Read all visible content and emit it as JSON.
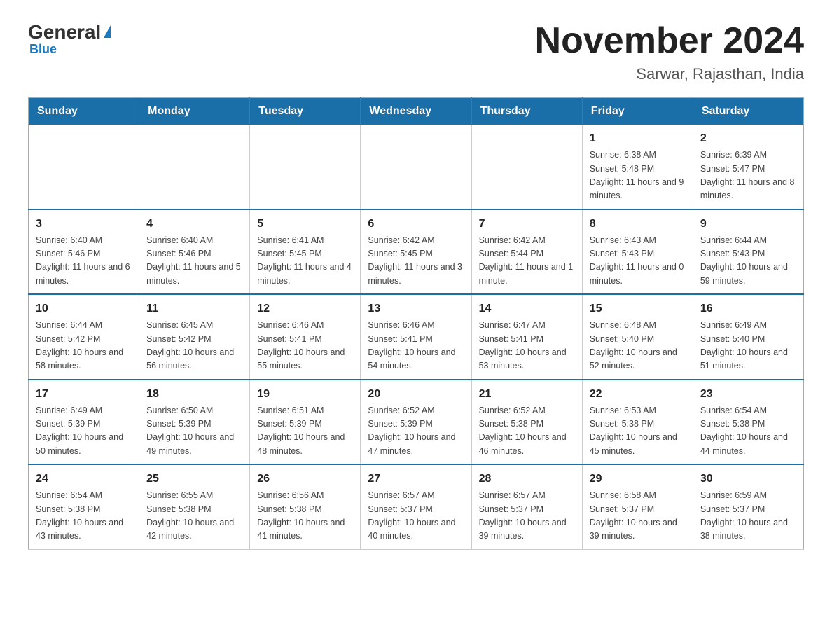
{
  "logo": {
    "general": "General",
    "blue": "Blue"
  },
  "header": {
    "title": "November 2024",
    "location": "Sarwar, Rajasthan, India"
  },
  "weekdays": [
    "Sunday",
    "Monday",
    "Tuesday",
    "Wednesday",
    "Thursday",
    "Friday",
    "Saturday"
  ],
  "weeks": [
    [
      {
        "day": "",
        "info": ""
      },
      {
        "day": "",
        "info": ""
      },
      {
        "day": "",
        "info": ""
      },
      {
        "day": "",
        "info": ""
      },
      {
        "day": "",
        "info": ""
      },
      {
        "day": "1",
        "info": "Sunrise: 6:38 AM\nSunset: 5:48 PM\nDaylight: 11 hours and 9 minutes."
      },
      {
        "day": "2",
        "info": "Sunrise: 6:39 AM\nSunset: 5:47 PM\nDaylight: 11 hours and 8 minutes."
      }
    ],
    [
      {
        "day": "3",
        "info": "Sunrise: 6:40 AM\nSunset: 5:46 PM\nDaylight: 11 hours and 6 minutes."
      },
      {
        "day": "4",
        "info": "Sunrise: 6:40 AM\nSunset: 5:46 PM\nDaylight: 11 hours and 5 minutes."
      },
      {
        "day": "5",
        "info": "Sunrise: 6:41 AM\nSunset: 5:45 PM\nDaylight: 11 hours and 4 minutes."
      },
      {
        "day": "6",
        "info": "Sunrise: 6:42 AM\nSunset: 5:45 PM\nDaylight: 11 hours and 3 minutes."
      },
      {
        "day": "7",
        "info": "Sunrise: 6:42 AM\nSunset: 5:44 PM\nDaylight: 11 hours and 1 minute."
      },
      {
        "day": "8",
        "info": "Sunrise: 6:43 AM\nSunset: 5:43 PM\nDaylight: 11 hours and 0 minutes."
      },
      {
        "day": "9",
        "info": "Sunrise: 6:44 AM\nSunset: 5:43 PM\nDaylight: 10 hours and 59 minutes."
      }
    ],
    [
      {
        "day": "10",
        "info": "Sunrise: 6:44 AM\nSunset: 5:42 PM\nDaylight: 10 hours and 58 minutes."
      },
      {
        "day": "11",
        "info": "Sunrise: 6:45 AM\nSunset: 5:42 PM\nDaylight: 10 hours and 56 minutes."
      },
      {
        "day": "12",
        "info": "Sunrise: 6:46 AM\nSunset: 5:41 PM\nDaylight: 10 hours and 55 minutes."
      },
      {
        "day": "13",
        "info": "Sunrise: 6:46 AM\nSunset: 5:41 PM\nDaylight: 10 hours and 54 minutes."
      },
      {
        "day": "14",
        "info": "Sunrise: 6:47 AM\nSunset: 5:41 PM\nDaylight: 10 hours and 53 minutes."
      },
      {
        "day": "15",
        "info": "Sunrise: 6:48 AM\nSunset: 5:40 PM\nDaylight: 10 hours and 52 minutes."
      },
      {
        "day": "16",
        "info": "Sunrise: 6:49 AM\nSunset: 5:40 PM\nDaylight: 10 hours and 51 minutes."
      }
    ],
    [
      {
        "day": "17",
        "info": "Sunrise: 6:49 AM\nSunset: 5:39 PM\nDaylight: 10 hours and 50 minutes."
      },
      {
        "day": "18",
        "info": "Sunrise: 6:50 AM\nSunset: 5:39 PM\nDaylight: 10 hours and 49 minutes."
      },
      {
        "day": "19",
        "info": "Sunrise: 6:51 AM\nSunset: 5:39 PM\nDaylight: 10 hours and 48 minutes."
      },
      {
        "day": "20",
        "info": "Sunrise: 6:52 AM\nSunset: 5:39 PM\nDaylight: 10 hours and 47 minutes."
      },
      {
        "day": "21",
        "info": "Sunrise: 6:52 AM\nSunset: 5:38 PM\nDaylight: 10 hours and 46 minutes."
      },
      {
        "day": "22",
        "info": "Sunrise: 6:53 AM\nSunset: 5:38 PM\nDaylight: 10 hours and 45 minutes."
      },
      {
        "day": "23",
        "info": "Sunrise: 6:54 AM\nSunset: 5:38 PM\nDaylight: 10 hours and 44 minutes."
      }
    ],
    [
      {
        "day": "24",
        "info": "Sunrise: 6:54 AM\nSunset: 5:38 PM\nDaylight: 10 hours and 43 minutes."
      },
      {
        "day": "25",
        "info": "Sunrise: 6:55 AM\nSunset: 5:38 PM\nDaylight: 10 hours and 42 minutes."
      },
      {
        "day": "26",
        "info": "Sunrise: 6:56 AM\nSunset: 5:38 PM\nDaylight: 10 hours and 41 minutes."
      },
      {
        "day": "27",
        "info": "Sunrise: 6:57 AM\nSunset: 5:37 PM\nDaylight: 10 hours and 40 minutes."
      },
      {
        "day": "28",
        "info": "Sunrise: 6:57 AM\nSunset: 5:37 PM\nDaylight: 10 hours and 39 minutes."
      },
      {
        "day": "29",
        "info": "Sunrise: 6:58 AM\nSunset: 5:37 PM\nDaylight: 10 hours and 39 minutes."
      },
      {
        "day": "30",
        "info": "Sunrise: 6:59 AM\nSunset: 5:37 PM\nDaylight: 10 hours and 38 minutes."
      }
    ]
  ]
}
